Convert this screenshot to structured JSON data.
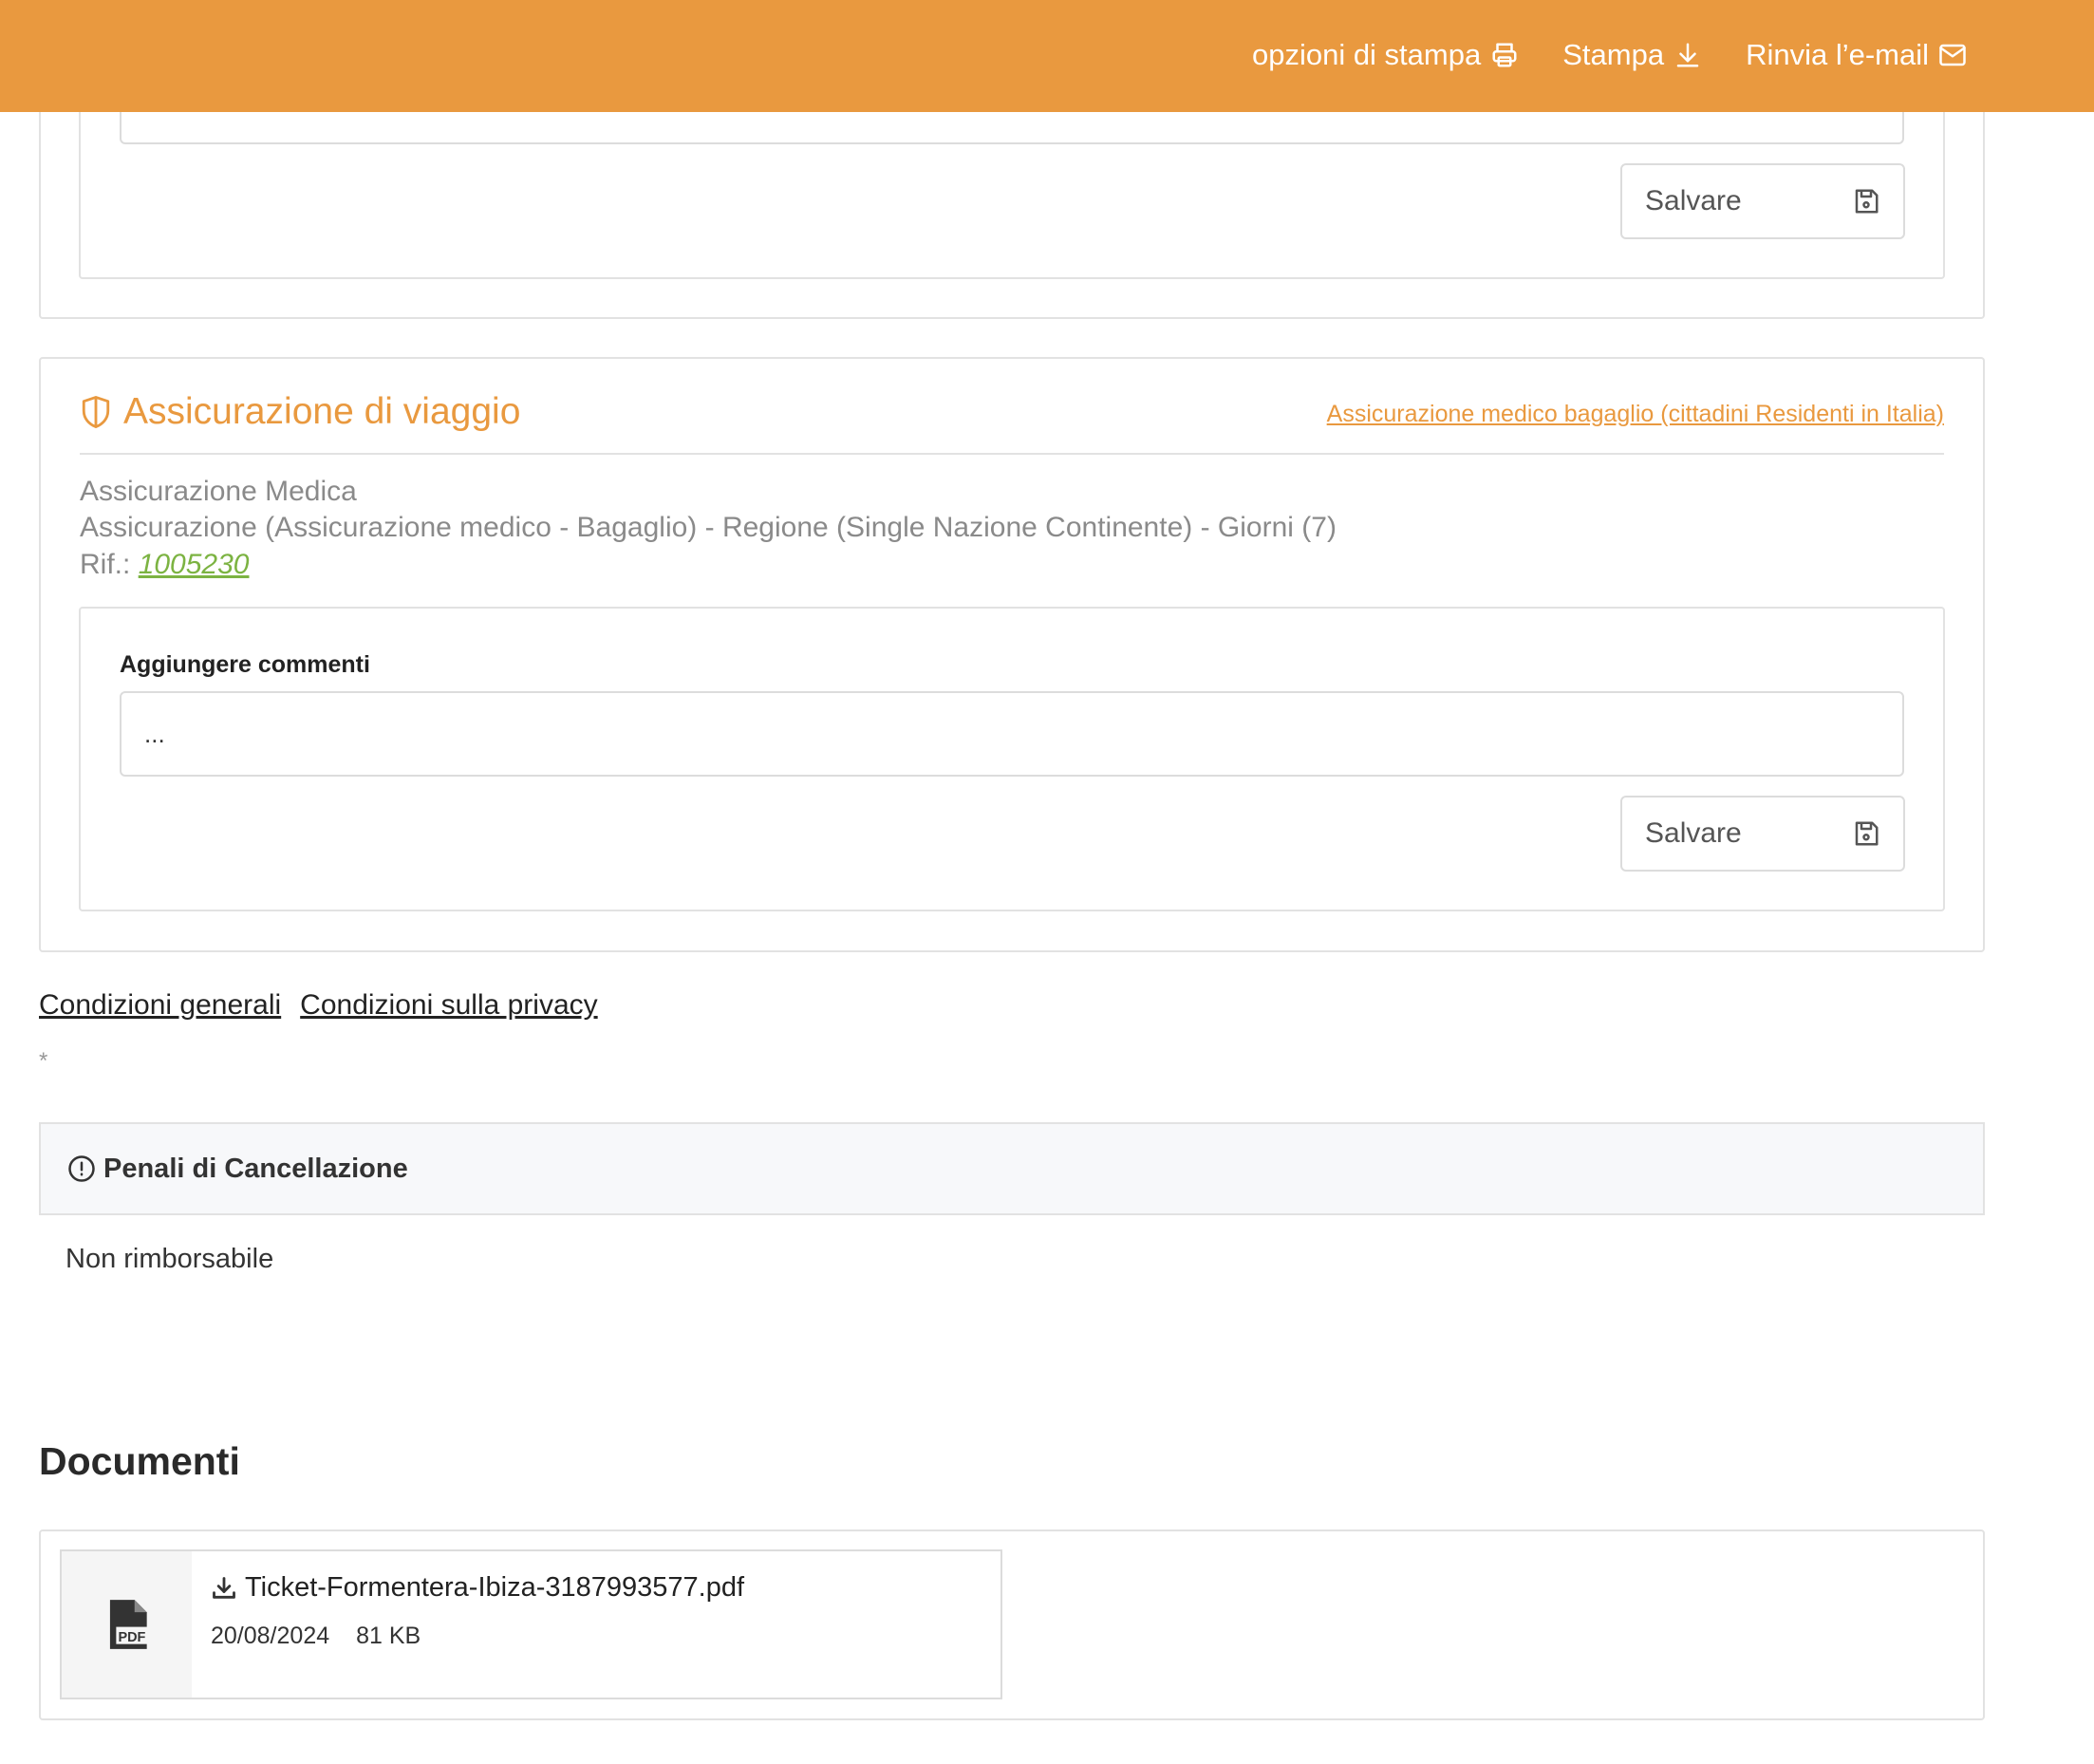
{
  "topbar": {
    "print_options_label": "opzioni di stampa",
    "print_label": "Stampa",
    "resend_email_label": "Rinvia l’e-mail"
  },
  "upper_section": {
    "save_label": "Salvare"
  },
  "insurance": {
    "title": "Assicurazione di viaggio",
    "policy_link": "Assicurazione medico bagaglio (cittadini Residenti in Italia)",
    "type": "Assicurazione Medica",
    "description": "Assicurazione (Assicurazione medico - Bagaglio) - Regione (Single Nazione Continente) - Giorni (7)",
    "ref_label": "Rif.:",
    "ref_value": "1005230",
    "comments_label": "Aggiungere commenti",
    "comments_placeholder": "...",
    "save_label": "Salvare"
  },
  "links": {
    "general_conditions": "Condizioni generali",
    "privacy_conditions": "Condizioni sulla privacy",
    "asterisk": "*"
  },
  "cancellation": {
    "title": "Penali di Cancellazione",
    "text": "Non rimborsabile"
  },
  "documents": {
    "title": "Documenti",
    "items": [
      {
        "name": "Ticket-Formentera-Ibiza-3187993577.pdf",
        "date": "20/08/2024",
        "size": "81 KB",
        "thumb_text": "PDF"
      }
    ]
  },
  "colors": {
    "accent": "#E9993F",
    "link_green": "#7CB342"
  }
}
